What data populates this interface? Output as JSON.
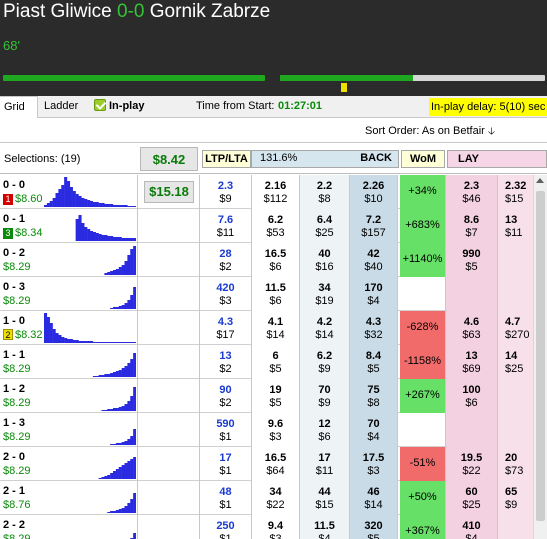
{
  "match": {
    "home": "Piast Gliwice",
    "score": "0-0",
    "away": "Gornik Zabrze",
    "minute": "68'",
    "second_half_progress": 0.5
  },
  "tabs": {
    "grid": "Grid",
    "ladder": "Ladder",
    "inplay": "In-play"
  },
  "time_from_start": {
    "label": "Time from Start:",
    "value": "01:27:01"
  },
  "inplay_delay": "In-play delay: 5(10) sec",
  "sort": {
    "label": "Sort Order: As on Betfair",
    "icon": "arrow-down-icon"
  },
  "header": {
    "selections": "Selections: (19)",
    "total": "$8.42",
    "ltp_lta": "LTP/LTA",
    "book": "131.6%",
    "back": "BACK",
    "wom": "WoM",
    "lay": "LAY"
  },
  "colors": {
    "wom_green": "#66e066",
    "wom_red": "#f26b6b",
    "ltp_blue": "#1a3ad0",
    "pl_green": "#0a8a0a",
    "histogram": "#2a2ae0"
  },
  "rows": [
    {
      "name": "0 - 0",
      "badge": "1",
      "badge_color": "red",
      "pl": "$8.60",
      "hedge": "$15.18",
      "ltp": "2.3",
      "ltp_amt": "$9",
      "back3": "2.16",
      "back3_amt": "$112",
      "back2": "2.2",
      "back2_amt": "$8",
      "back1": "2.26",
      "back1_amt": "$10",
      "wom": "+34%",
      "wom_type": "green",
      "lay1": "2.3",
      "lay1_amt": "$46",
      "lay2": "2.32",
      "lay2_amt": "$15",
      "hist": [
        2,
        4,
        6,
        9,
        14,
        18,
        22,
        30,
        26,
        20,
        16,
        13,
        11,
        9,
        8,
        7,
        6,
        5,
        5,
        4,
        4,
        3,
        3,
        3,
        2,
        2,
        2,
        2,
        2,
        1,
        1,
        1
      ]
    },
    {
      "name": "0 - 1",
      "badge": "3",
      "badge_color": "green",
      "pl": "$8.34",
      "hedge": "",
      "ltp": "7.6",
      "ltp_amt": "$11",
      "back3": "6.2",
      "back3_amt": "$53",
      "back2": "6.4",
      "back2_amt": "$25",
      "back1": "7.2",
      "back1_amt": "$157",
      "wom": "+683%",
      "wom_type": "green",
      "lay1": "8.6",
      "lay1_amt": "$7",
      "lay2": "13",
      "lay2_amt": "$11",
      "hist": [
        0,
        0,
        0,
        0,
        0,
        0,
        0,
        0,
        0,
        0,
        0,
        22,
        26,
        18,
        14,
        12,
        10,
        9,
        8,
        7,
        6,
        6,
        5,
        5,
        4,
        4,
        4,
        3,
        3,
        3,
        3,
        3
      ]
    },
    {
      "name": "0 - 2",
      "badge": "",
      "badge_color": "",
      "pl": "$8.29",
      "hedge": "",
      "ltp": "28",
      "ltp_amt": "$2",
      "back3": "16.5",
      "back3_amt": "$6",
      "back2": "40",
      "back2_amt": "$16",
      "back1": "42",
      "back1_amt": "$40",
      "wom": "+1140%",
      "wom_type": "green",
      "lay1": "990",
      "lay1_amt": "$5",
      "lay2": "",
      "lay2_amt": "",
      "hist": [
        0,
        0,
        0,
        0,
        0,
        0,
        0,
        0,
        0,
        0,
        0,
        0,
        0,
        0,
        0,
        0,
        0,
        0,
        0,
        0,
        0,
        2,
        3,
        4,
        5,
        6,
        8,
        10,
        14,
        20,
        26,
        29
      ]
    },
    {
      "name": "0 - 3",
      "badge": "",
      "badge_color": "",
      "pl": "$8.29",
      "hedge": "",
      "ltp": "420",
      "ltp_amt": "$3",
      "back3": "11.5",
      "back3_amt": "$6",
      "back2": "34",
      "back2_amt": "$19",
      "back1": "170",
      "back1_amt": "$4",
      "wom": "",
      "wom_type": "none",
      "lay1": "",
      "lay1_amt": "",
      "lay2": "",
      "lay2_amt": "",
      "hist": [
        0,
        0,
        0,
        0,
        0,
        0,
        0,
        0,
        0,
        0,
        0,
        0,
        0,
        0,
        0,
        0,
        0,
        0,
        0,
        0,
        0,
        0,
        0,
        1,
        2,
        2,
        3,
        4,
        6,
        9,
        14,
        22
      ]
    },
    {
      "name": "1 - 0",
      "badge": "2",
      "badge_color": "yellow",
      "pl": "$8.32",
      "hedge": "",
      "ltp": "4.3",
      "ltp_amt": "$17",
      "back3": "4.1",
      "back3_amt": "$14",
      "back2": "4.2",
      "back2_amt": "$14",
      "back1": "4.3",
      "back1_amt": "$32",
      "wom": "-628%",
      "wom_type": "red",
      "lay1": "4.6",
      "lay1_amt": "$63",
      "lay2": "4.7",
      "lay2_amt": "$270",
      "hist": [
        30,
        26,
        20,
        14,
        10,
        8,
        6,
        5,
        4,
        4,
        3,
        3,
        2,
        2,
        2,
        2,
        2,
        1,
        1,
        1,
        1,
        1,
        1,
        1,
        1,
        1,
        1,
        1,
        1,
        1,
        1,
        1
      ]
    },
    {
      "name": "1 - 1",
      "badge": "",
      "badge_color": "",
      "pl": "$8.29",
      "hedge": "",
      "ltp": "13",
      "ltp_amt": "$2",
      "back3": "6",
      "back3_amt": "$5",
      "back2": "6.2",
      "back2_amt": "$9",
      "back1": "8.4",
      "back1_amt": "$5",
      "wom": "-1158%",
      "wom_type": "red",
      "lay1": "13",
      "lay1_amt": "$69",
      "lay2": "14",
      "lay2_amt": "$25",
      "hist": [
        0,
        0,
        0,
        0,
        0,
        0,
        0,
        0,
        0,
        0,
        0,
        0,
        0,
        0,
        0,
        0,
        0,
        1,
        1,
        2,
        2,
        3,
        3,
        4,
        5,
        6,
        7,
        9,
        11,
        14,
        18,
        24
      ]
    },
    {
      "name": "1 - 2",
      "badge": "",
      "badge_color": "",
      "pl": "$8.29",
      "hedge": "",
      "ltp": "90",
      "ltp_amt": "$2",
      "back3": "19",
      "back3_amt": "$5",
      "back2": "70",
      "back2_amt": "$9",
      "back1": "75",
      "back1_amt": "$8",
      "wom": "+267%",
      "wom_type": "green",
      "lay1": "100",
      "lay1_amt": "$6",
      "lay2": "",
      "lay2_amt": "",
      "hist": [
        0,
        0,
        0,
        0,
        0,
        0,
        0,
        0,
        0,
        0,
        0,
        0,
        0,
        0,
        0,
        0,
        0,
        0,
        0,
        0,
        1,
        1,
        2,
        2,
        3,
        3,
        4,
        5,
        7,
        10,
        15,
        24
      ]
    },
    {
      "name": "1 - 3",
      "badge": "",
      "badge_color": "",
      "pl": "$8.29",
      "hedge": "",
      "ltp": "590",
      "ltp_amt": "$1",
      "back3": "9.6",
      "back3_amt": "$3",
      "back2": "12",
      "back2_amt": "$6",
      "back1": "70",
      "back1_amt": "$4",
      "wom": "",
      "wom_type": "none",
      "lay1": "",
      "lay1_amt": "",
      "lay2": "",
      "lay2_amt": "",
      "hist": [
        0,
        0,
        0,
        0,
        0,
        0,
        0,
        0,
        0,
        0,
        0,
        0,
        0,
        0,
        0,
        0,
        0,
        0,
        0,
        0,
        0,
        0,
        0,
        1,
        1,
        2,
        2,
        3,
        4,
        6,
        9,
        16
      ]
    },
    {
      "name": "2 - 0",
      "badge": "",
      "badge_color": "",
      "pl": "$8.29",
      "hedge": "",
      "ltp": "17",
      "ltp_amt": "$1",
      "back3": "16.5",
      "back3_amt": "$64",
      "back2": "17",
      "back2_amt": "$11",
      "back1": "17.5",
      "back1_amt": "$3",
      "wom": "-51%",
      "wom_type": "red",
      "lay1": "19.5",
      "lay1_amt": "$22",
      "lay2": "20",
      "lay2_amt": "$73",
      "hist": [
        0,
        0,
        0,
        0,
        0,
        0,
        0,
        0,
        0,
        0,
        0,
        0,
        0,
        0,
        0,
        0,
        0,
        0,
        0,
        1,
        2,
        3,
        4,
        6,
        8,
        10,
        12,
        14,
        16,
        18,
        20,
        22
      ]
    },
    {
      "name": "2 - 1",
      "badge": "",
      "badge_color": "",
      "pl": "$8.76",
      "hedge": "",
      "ltp": "48",
      "ltp_amt": "$1",
      "back3": "34",
      "back3_amt": "$22",
      "back2": "44",
      "back2_amt": "$15",
      "back1": "46",
      "back1_amt": "$14",
      "wom": "+50%",
      "wom_type": "green",
      "lay1": "60",
      "lay1_amt": "$25",
      "lay2": "65",
      "lay2_amt": "$9",
      "hist": [
        0,
        0,
        0,
        0,
        0,
        0,
        0,
        0,
        0,
        0,
        0,
        0,
        0,
        0,
        0,
        0,
        0,
        0,
        0,
        0,
        0,
        0,
        1,
        2,
        2,
        3,
        4,
        5,
        7,
        10,
        14,
        20
      ]
    },
    {
      "name": "2 - 2",
      "badge": "",
      "badge_color": "",
      "pl": "$8.29",
      "hedge": "",
      "ltp": "250",
      "ltp_amt": "$1",
      "back3": "9.4",
      "back3_amt": "$3",
      "back2": "11.5",
      "back2_amt": "$4",
      "back1": "320",
      "back1_amt": "$5",
      "wom": "+367%",
      "wom_type": "green",
      "lay1": "410",
      "lay1_amt": "$4",
      "lay2": "",
      "lay2_amt": "",
      "hist": [
        0,
        0,
        0,
        0,
        0,
        0,
        0,
        0,
        0,
        0,
        0,
        0,
        0,
        0,
        0,
        0,
        0,
        0,
        0,
        0,
        0,
        0,
        0,
        0,
        1,
        1,
        2,
        3,
        4,
        6,
        9,
        14
      ]
    }
  ]
}
